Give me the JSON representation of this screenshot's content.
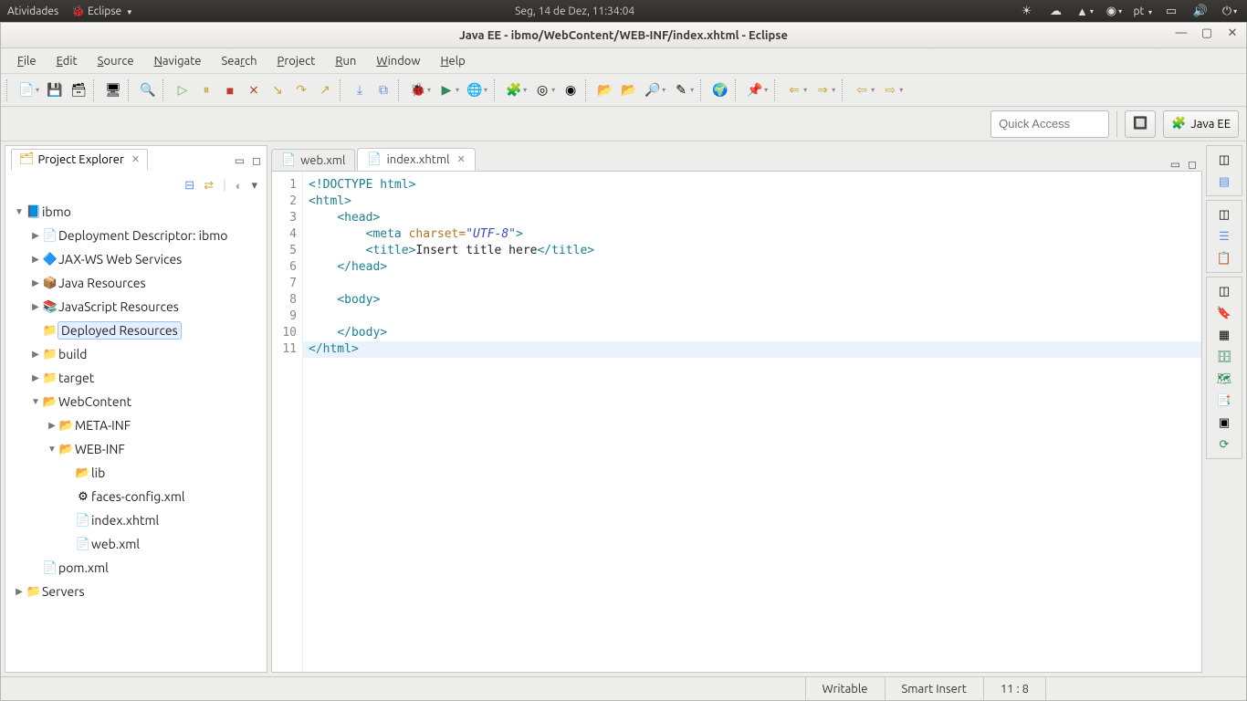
{
  "os_bar": {
    "activities": "Atividades",
    "app": "Eclipse",
    "datetime": "Seg, 14 de Dez, 11:34:04",
    "lang": "pt"
  },
  "window": {
    "title": "Java EE - ibmo/WebContent/WEB-INF/index.xhtml - Eclipse"
  },
  "menus": [
    "File",
    "Edit",
    "Source",
    "Navigate",
    "Search",
    "Project",
    "Run",
    "Window",
    "Help"
  ],
  "quick_access_placeholder": "Quick Access",
  "perspective_button": "Java EE",
  "explorer": {
    "title": "Project Explorer",
    "tree": [
      {
        "ind": 0,
        "tw": "▼",
        "ic": "📘",
        "icc": "icon-proj",
        "label": "ibmo",
        "cls": ""
      },
      {
        "ind": 1,
        "tw": "▶",
        "ic": "📄",
        "icc": "icon-file",
        "label": "Deployment Descriptor: ibmo",
        "cls": ""
      },
      {
        "ind": 1,
        "tw": "▶",
        "ic": "🔷",
        "icc": "",
        "label": "JAX-WS Web Services",
        "cls": ""
      },
      {
        "ind": 1,
        "tw": "▶",
        "ic": "📦",
        "icc": "",
        "label": "Java Resources",
        "cls": ""
      },
      {
        "ind": 1,
        "tw": "▶",
        "ic": "📚",
        "icc": "",
        "label": "JavaScript Resources",
        "cls": ""
      },
      {
        "ind": 1,
        "tw": "",
        "ic": "📁",
        "icc": "icon-folder-open",
        "label": "Deployed Resources",
        "cls": "sel"
      },
      {
        "ind": 1,
        "tw": "▶",
        "ic": "📁",
        "icc": "icon-folder",
        "label": "build",
        "cls": ""
      },
      {
        "ind": 1,
        "tw": "▶",
        "ic": "📁",
        "icc": "icon-folder",
        "label": "target",
        "cls": ""
      },
      {
        "ind": 1,
        "tw": "▼",
        "ic": "📂",
        "icc": "icon-folder-open",
        "label": "WebContent",
        "cls": ""
      },
      {
        "ind": 2,
        "tw": "▶",
        "ic": "📂",
        "icc": "icon-folder-open",
        "label": "META-INF",
        "cls": ""
      },
      {
        "ind": 2,
        "tw": "▼",
        "ic": "📂",
        "icc": "icon-folder-open",
        "label": "WEB-INF",
        "cls": ""
      },
      {
        "ind": 3,
        "tw": "",
        "ic": "📂",
        "icc": "icon-folder-open",
        "label": "lib",
        "cls": ""
      },
      {
        "ind": 3,
        "tw": "",
        "ic": "⚙",
        "icc": "",
        "label": "faces-config.xml",
        "cls": ""
      },
      {
        "ind": 3,
        "tw": "",
        "ic": "📄",
        "icc": "icon-file",
        "label": "index.xhtml",
        "cls": ""
      },
      {
        "ind": 3,
        "tw": "",
        "ic": "📄",
        "icc": "icon-xml",
        "label": "web.xml",
        "cls": ""
      },
      {
        "ind": 1,
        "tw": "",
        "ic": "📄",
        "icc": "icon-file",
        "label": "pom.xml",
        "cls": ""
      },
      {
        "ind": 0,
        "tw": "▶",
        "ic": "📁",
        "icc": "icon-folder",
        "label": "Servers",
        "cls": ""
      }
    ]
  },
  "editor_tabs": [
    {
      "icon": "📄",
      "label": "web.xml",
      "active": false
    },
    {
      "icon": "📄",
      "label": "index.xhtml",
      "active": true
    }
  ],
  "code_lines": [
    {
      "n": 1,
      "html": "<span class='t-doctype'>&lt;!DOCTYPE</span> <span class='t-tag'>html</span><span class='t-doctype'>&gt;</span>"
    },
    {
      "n": 2,
      "html": "<span class='t-tag'>&lt;html&gt;</span>"
    },
    {
      "n": 3,
      "html": "    <span class='t-tag'>&lt;head&gt;</span>"
    },
    {
      "n": 4,
      "html": "        <span class='t-tag'>&lt;meta</span> <span class='t-attr'>charset=</span><span class='t-str'>\"UTF-8\"</span><span class='t-tag'>&gt;</span>"
    },
    {
      "n": 5,
      "html": "        <span class='t-tag'>&lt;title&gt;</span><span class='t-text'>Insert title here</span><span class='t-tag'>&lt;/title&gt;</span>"
    },
    {
      "n": 6,
      "html": "    <span class='t-tag'>&lt;/head&gt;</span>"
    },
    {
      "n": 7,
      "html": ""
    },
    {
      "n": 8,
      "html": "    <span class='t-tag'>&lt;body&gt;</span>"
    },
    {
      "n": 9,
      "html": ""
    },
    {
      "n": 10,
      "html": "    <span class='t-tag'>&lt;/body&gt;</span>"
    },
    {
      "n": 11,
      "html": "<span class='t-tag'>&lt;/html&gt;</span>"
    }
  ],
  "highlight_row": 11,
  "status": {
    "writable": "Writable",
    "mode": "Smart Insert",
    "pos": "11 : 8"
  }
}
